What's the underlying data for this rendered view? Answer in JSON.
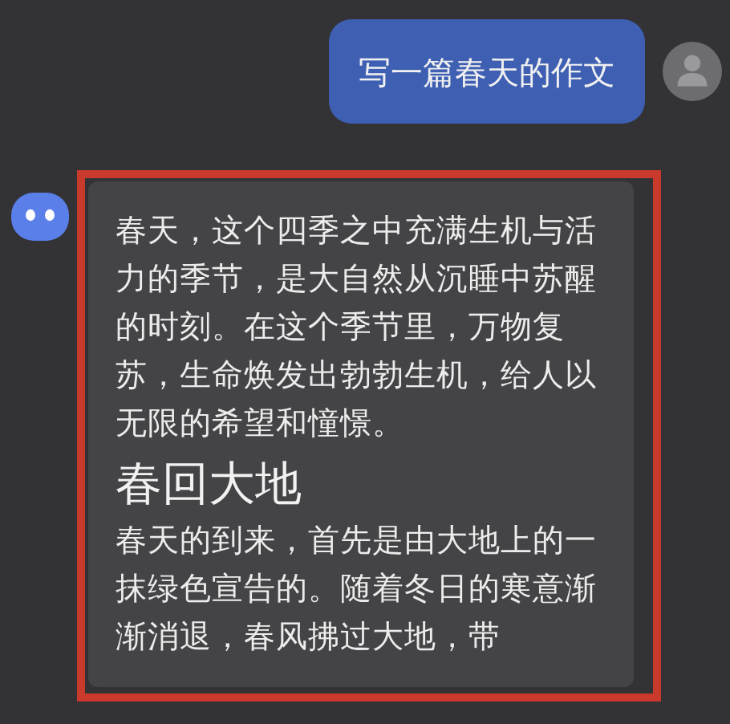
{
  "user_message": {
    "text": "写一篇春天的作文"
  },
  "bot_message": {
    "highlighted": true,
    "blocks": [
      {
        "kind": "paragraph",
        "text": "春天，这个四季之中充满生机与活力的季节，是大自然从沉睡中苏醒的时刻。在这个季节里，万物复苏，生命焕发出勃勃生机，给人以无限的希望和憧憬。"
      },
      {
        "kind": "heading",
        "text": "春回大地"
      },
      {
        "kind": "paragraph",
        "text": "春天的到来，首先是由大地上的一抹绿色宣告的。随着冬日的寒意渐渐消退，春风拂过大地，带"
      }
    ]
  }
}
